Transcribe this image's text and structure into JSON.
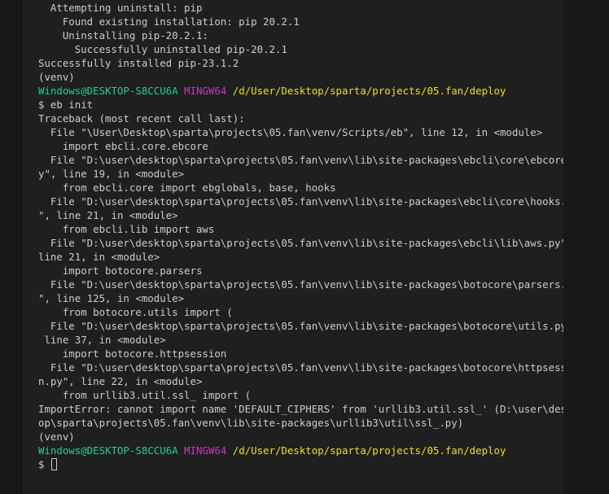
{
  "terminal": {
    "lines": [
      [
        {
          "t": "  Attempting uninstall: pip",
          "c": "default"
        }
      ],
      [
        {
          "t": "    Found existing installation: pip 20.2.1",
          "c": "default"
        }
      ],
      [
        {
          "t": "    Uninstalling pip-20.2.1:",
          "c": "default"
        }
      ],
      [
        {
          "t": "      Successfully uninstalled pip-20.2.1",
          "c": "default"
        }
      ],
      [
        {
          "t": "Successfully installed pip-23.1.2",
          "c": "default"
        }
      ],
      [
        {
          "t": "(venv)",
          "c": "default"
        }
      ],
      [
        {
          "t": "Windows@DESKTOP-S8CCU6A",
          "c": "user"
        },
        {
          "t": " ",
          "c": "default"
        },
        {
          "t": "MINGW64",
          "c": "mingw"
        },
        {
          "t": " ",
          "c": "default"
        },
        {
          "t": "/d/User/Desktop/sparta/projects/05.fan/deploy",
          "c": "path"
        }
      ],
      [
        {
          "t": "$ eb init",
          "c": "default"
        }
      ],
      [
        {
          "t": "Traceback (most recent call last):",
          "c": "default"
        }
      ],
      [
        {
          "t": "  File \"\\User\\Desktop\\sparta\\projects\\05.fan\\venv/Scripts/eb\", line 12, in <module>",
          "c": "default"
        }
      ],
      [
        {
          "t": "    import ebcli.core.ebcore",
          "c": "default"
        }
      ],
      [
        {
          "t": "  File \"D:\\user\\desktop\\sparta\\projects\\05.fan\\venv\\lib\\site-packages\\ebcli\\core\\ebcore.p",
          "c": "default"
        }
      ],
      [
        {
          "t": "y\", line 19, in <module>",
          "c": "default"
        }
      ],
      [
        {
          "t": "    from ebcli.core import ebglobals, base, hooks",
          "c": "default"
        }
      ],
      [
        {
          "t": "  File \"D:\\user\\desktop\\sparta\\projects\\05.fan\\venv\\lib\\site-packages\\ebcli\\core\\hooks.py",
          "c": "default"
        }
      ],
      [
        {
          "t": "\", line 21, in <module>",
          "c": "default"
        }
      ],
      [
        {
          "t": "    from ebcli.lib import aws",
          "c": "default"
        }
      ],
      [
        {
          "t": "  File \"D:\\user\\desktop\\sparta\\projects\\05.fan\\venv\\lib\\site-packages\\ebcli\\lib\\aws.py\",",
          "c": "default"
        }
      ],
      [
        {
          "t": "line 21, in <module>",
          "c": "default"
        }
      ],
      [
        {
          "t": "    import botocore.parsers",
          "c": "default"
        }
      ],
      [
        {
          "t": "  File \"D:\\user\\desktop\\sparta\\projects\\05.fan\\venv\\lib\\site-packages\\botocore\\parsers.py",
          "c": "default"
        }
      ],
      [
        {
          "t": "\", line 125, in <module>",
          "c": "default"
        }
      ],
      [
        {
          "t": "    from botocore.utils import (",
          "c": "default"
        }
      ],
      [
        {
          "t": "  File \"D:\\user\\desktop\\sparta\\projects\\05.fan\\venv\\lib\\site-packages\\botocore\\utils.py\",",
          "c": "default"
        }
      ],
      [
        {
          "t": " line 37, in <module>",
          "c": "default"
        }
      ],
      [
        {
          "t": "    import botocore.httpsession",
          "c": "default"
        }
      ],
      [
        {
          "t": "  File \"D:\\user\\desktop\\sparta\\projects\\05.fan\\venv\\lib\\site-packages\\botocore\\httpsessio",
          "c": "default"
        }
      ],
      [
        {
          "t": "n.py\", line 22, in <module>",
          "c": "default"
        }
      ],
      [
        {
          "t": "    from urllib3.util.ssl_ import (",
          "c": "default"
        }
      ],
      [
        {
          "t": "ImportError: cannot import name 'DEFAULT_CIPHERS' from 'urllib3.util.ssl_' (D:\\user\\deskt",
          "c": "default"
        }
      ],
      [
        {
          "t": "op\\sparta\\projects\\05.fan\\venv\\lib\\site-packages\\urllib3\\util\\ssl_.py)",
          "c": "default"
        }
      ],
      [
        {
          "t": "(venv)",
          "c": "default"
        }
      ],
      [
        {
          "t": "Windows@DESKTOP-S8CCU6A",
          "c": "user"
        },
        {
          "t": " ",
          "c": "default"
        },
        {
          "t": "MINGW64",
          "c": "mingw"
        },
        {
          "t": " ",
          "c": "default"
        },
        {
          "t": "/d/User/Desktop/sparta/projects/05.fan/deploy",
          "c": "path"
        }
      ],
      [
        {
          "t": "$ ",
          "c": "default"
        }
      ]
    ],
    "cursor": "block-outline",
    "scroll": {
      "thumb_start": 0.78,
      "thumb_end": 0.965
    }
  },
  "colors": {
    "background": "#1f1f1f",
    "foreground": "#cccccc",
    "user": "#23d18b",
    "mingw": "#bc3fbc",
    "path": "#e5e510"
  }
}
